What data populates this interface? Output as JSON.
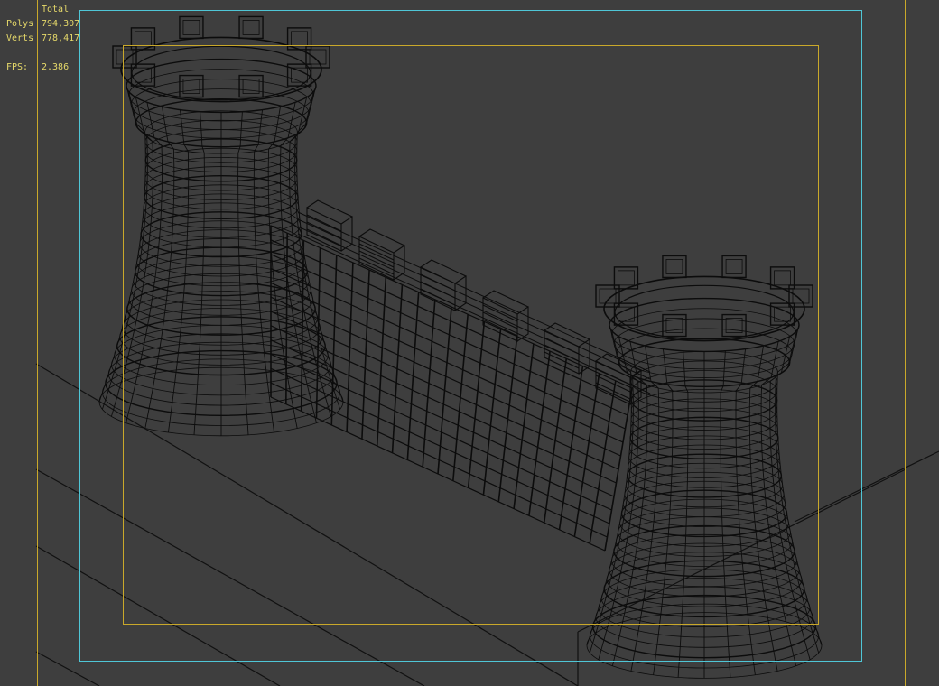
{
  "stats": {
    "header": "Total",
    "rows": [
      {
        "label": "Polys",
        "value": "794,307"
      },
      {
        "label": "Verts",
        "value": "778,417"
      }
    ],
    "fps_label": "FPS:",
    "fps_value": "2.386"
  },
  "colors": {
    "background": "#3e3e3e",
    "wire": "#0c0c0c",
    "ground_line": "#111111",
    "outer_frame": "#c9a82a",
    "safe_frame": "#4fc6d6",
    "action_frame": "#c9a82a",
    "stats_text": "#e6d96a"
  },
  "scene": {
    "description_icon": "castle-wireframe-icon",
    "objects": [
      "tower-left",
      "tower-right",
      "curtain-wall"
    ]
  }
}
